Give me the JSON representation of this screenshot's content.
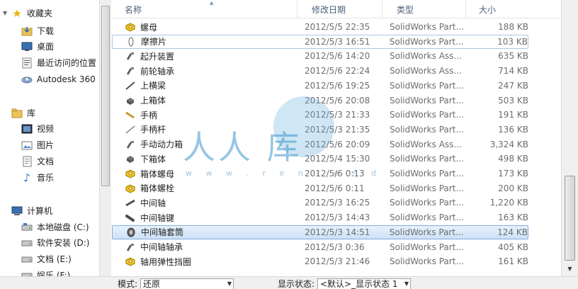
{
  "nav": {
    "favorites_label": "收藏夹",
    "favorites": [
      {
        "label": "下载",
        "icon": "download-folder-icon"
      },
      {
        "label": "桌面",
        "icon": "desktop-icon"
      },
      {
        "label": "最近访问的位置",
        "icon": "recent-places-icon"
      },
      {
        "label": "Autodesk 360",
        "icon": "autodesk-360-icon"
      }
    ],
    "libraries_label": "库",
    "libraries": [
      {
        "label": "视频",
        "icon": "video-library-icon"
      },
      {
        "label": "图片",
        "icon": "pictures-library-icon"
      },
      {
        "label": "文档",
        "icon": "documents-library-icon"
      },
      {
        "label": "音乐",
        "icon": "music-library-icon"
      }
    ],
    "computer_label": "计算机",
    "computer": [
      {
        "label": "本地磁盘 (C:)",
        "icon": "local-disk-icon"
      },
      {
        "label": "软件安装 (D:)",
        "icon": "drive-icon"
      },
      {
        "label": "文档 (E:)",
        "icon": "drive-icon"
      },
      {
        "label": "娱乐 (F:)",
        "icon": "drive-icon"
      }
    ]
  },
  "columns": {
    "name": "名称",
    "date": "修改日期",
    "type": "类型",
    "size": "大小"
  },
  "files": [
    {
      "name": "螺母",
      "date": "2012/5/5 22:35",
      "type": "SolidWorks Part...",
      "size": "188 KB",
      "icon": "part-yellow-icon"
    },
    {
      "name": "摩擦片",
      "date": "2012/5/3 16:51",
      "type": "SolidWorks Part...",
      "size": "103 KB",
      "icon": "part-disc-icon"
    },
    {
      "name": "起升装置",
      "date": "2012/5/6 14:20",
      "type": "SolidWorks Ass...",
      "size": "635 KB",
      "icon": "assembly-icon"
    },
    {
      "name": "前轮轴承",
      "date": "2012/5/6 22:24",
      "type": "SolidWorks Ass...",
      "size": "714 KB",
      "icon": "assembly-icon"
    },
    {
      "name": "上横梁",
      "date": "2012/5/6 19:25",
      "type": "SolidWorks Part...",
      "size": "247 KB",
      "icon": "part-beam-icon"
    },
    {
      "name": "上箱体",
      "date": "2012/5/6 20:08",
      "type": "SolidWorks Part...",
      "size": "503 KB",
      "icon": "part-box-icon"
    },
    {
      "name": "手柄",
      "date": "2012/5/3 21:33",
      "type": "SolidWorks Part...",
      "size": "191 KB",
      "icon": "part-handle-icon"
    },
    {
      "name": "手柄杆",
      "date": "2012/5/3 21:35",
      "type": "SolidWorks Part...",
      "size": "136 KB",
      "icon": "part-rod-icon"
    },
    {
      "name": "手动动力箱",
      "date": "2012/5/6 20:09",
      "type": "SolidWorks Ass...",
      "size": "3,324 KB",
      "icon": "assembly-icon"
    },
    {
      "name": "下箱体",
      "date": "2012/5/4 15:30",
      "type": "SolidWorks Part...",
      "size": "498 KB",
      "icon": "part-box-icon"
    },
    {
      "name": "箱体螺母",
      "date": "2012/5/6 0:13",
      "type": "SolidWorks Part...",
      "size": "173 KB",
      "icon": "part-yellow-icon"
    },
    {
      "name": "箱体螺栓",
      "date": "2012/5/6 0:11",
      "type": "SolidWorks Part...",
      "size": "200 KB",
      "icon": "part-yellow-icon"
    },
    {
      "name": "中间轴",
      "date": "2012/5/3 16:25",
      "type": "SolidWorks Part...",
      "size": "1,220 KB",
      "icon": "part-shaft-icon"
    },
    {
      "name": "中间轴键",
      "date": "2012/5/3 14:43",
      "type": "SolidWorks Part...",
      "size": "163 KB",
      "icon": "part-key-icon"
    },
    {
      "name": "中间轴套筒",
      "date": "2012/5/3 14:51",
      "type": "SolidWorks Part...",
      "size": "124 KB",
      "icon": "part-sleeve-icon"
    },
    {
      "name": "中间轴轴承",
      "date": "2012/5/3 0:36",
      "type": "SolidWorks Part...",
      "size": "405 KB",
      "icon": "assembly-icon"
    },
    {
      "name": "轴用弹性挡圈",
      "date": "2012/5/3 21:46",
      "type": "SolidWorks Part...",
      "size": "161 KB",
      "icon": "part-yellow-icon"
    }
  ],
  "selected_index": 14,
  "focused_index": 1,
  "bottom": {
    "mode_label": "模式:",
    "mode_value": "还原",
    "display_label": "显示状态:",
    "display_value": "<默认>_显示状态 1"
  },
  "watermark": {
    "text": "人人  库",
    "url": "w w w . r e n r e n d"
  },
  "colors": {
    "selection_bg": "#cde2f7",
    "selection_border": "#84acdd",
    "header_text": "#4c607a",
    "secondary_text": "#6d6d6d"
  }
}
